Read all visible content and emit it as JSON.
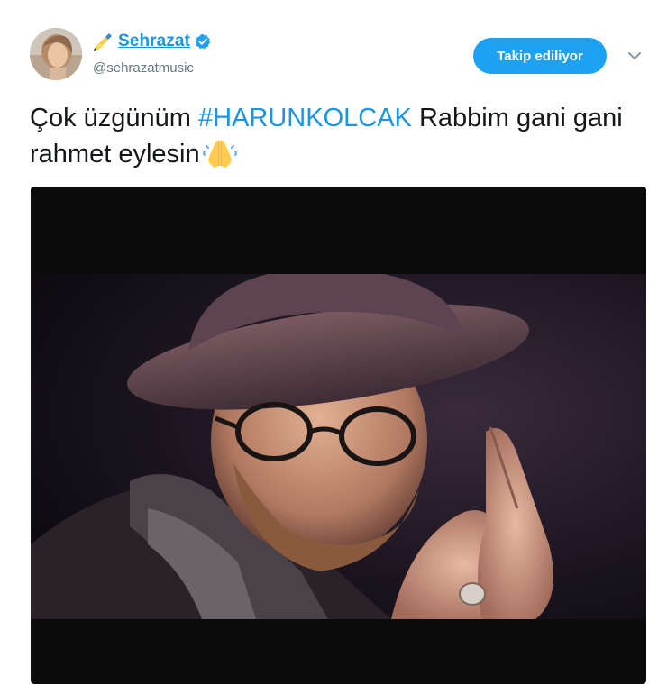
{
  "user": {
    "display_name": "Sehrazat",
    "name_emoji": "writing-hand-emoji",
    "verified": true,
    "handle": "@sehrazatmusic"
  },
  "follow_button": {
    "label": "Takip ediliyor"
  },
  "tweet": {
    "text_before": "Çok üzgünüm ",
    "hashtag": "#HARUNKOLCAK",
    "text_after": " Rabbim gani gani rahmet eylesin",
    "trailing_emoji": "folded-hands-emoji"
  },
  "colors": {
    "accent": "#1da1f2",
    "link": "#1b95e0",
    "secondary_text": "#657786",
    "primary_text": "#14171a",
    "media_background": "#0b0b0b"
  },
  "icons": {
    "verified": "verified-badge-icon",
    "more": "chevron-down-icon"
  }
}
